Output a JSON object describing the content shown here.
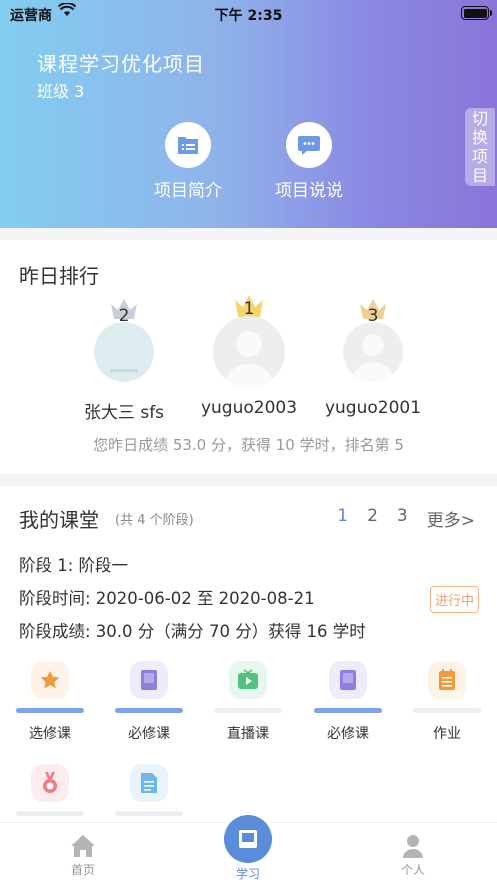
{
  "status_bar": {
    "carrier": "运营商",
    "time": "下午 2:35"
  },
  "header": {
    "title": "课程学习优化项目",
    "class_name": "班级 3",
    "switch_label_1": "切换",
    "switch_label_2": "项目",
    "buttons": [
      {
        "label": "项目简介",
        "icon": "list-folder-icon"
      },
      {
        "label": "项目说说",
        "icon": "chat-bubble-icon"
      }
    ],
    "accent_colors": [
      "#82cef0",
      "#8a74d9"
    ]
  },
  "ranking": {
    "title": "昨日排行",
    "people": [
      {
        "rank": "2",
        "name": "张大三 sfs"
      },
      {
        "rank": "1",
        "name": "yuguo2003"
      },
      {
        "rank": "3",
        "name": "yuguo2001"
      }
    ],
    "summary": "您昨日成绩 53.0 分，获得 10 学时，排名第 5"
  },
  "course": {
    "title": "我的课堂",
    "stages_count": "(共 4 个阶段)",
    "pager": {
      "pages": [
        "1",
        "2",
        "3"
      ],
      "more": "更多>"
    },
    "stage_name": "阶段 1:   阶段一",
    "stage_time": "阶段时间:  2020-06-02 至 2020-08-21",
    "stage_score": "阶段成绩:  30.0 分（满分 70 分）获得 16 学时",
    "status_badge": "进行中",
    "items": [
      {
        "label": "选修课",
        "icon": "star-icon",
        "progress": 1.0
      },
      {
        "label": "必修课",
        "icon": "book-icon",
        "progress": 1.0
      },
      {
        "label": "直播课",
        "icon": "play-tv-icon",
        "progress": 0
      },
      {
        "label": "必修课",
        "icon": "book-icon",
        "progress": 1.0
      },
      {
        "label": "作业",
        "icon": "notepad-icon",
        "progress": 0
      },
      {
        "label": "",
        "icon": "medal-icon",
        "progress": 0
      },
      {
        "label": "",
        "icon": "document-icon",
        "progress": 0
      }
    ]
  },
  "tabbar": {
    "tabs": [
      {
        "label": "首页",
        "icon": "home-icon"
      },
      {
        "label": "学习",
        "icon": "study-book-icon"
      },
      {
        "label": "个人",
        "icon": "person-icon"
      }
    ]
  }
}
